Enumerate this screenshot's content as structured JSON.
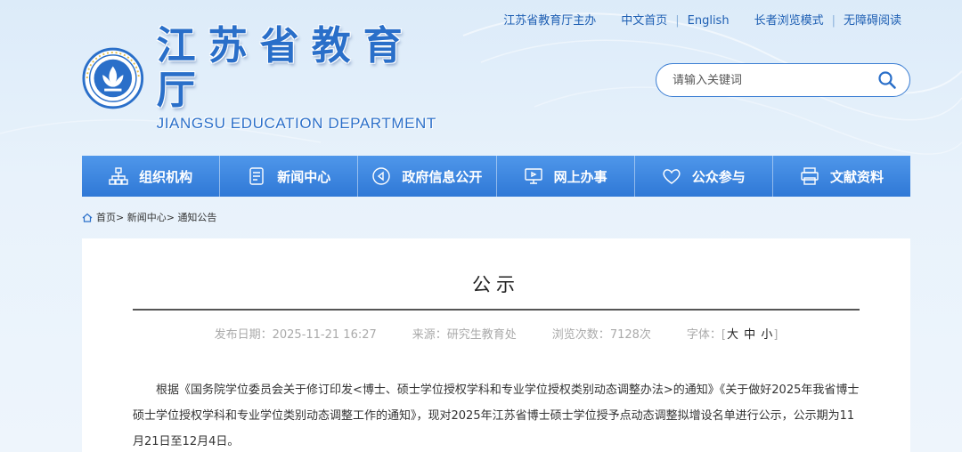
{
  "top_links": {
    "host": "江苏省教育厅主办",
    "home": "中文首页",
    "english": "English",
    "elder_mode": "长者浏览模式",
    "accessible": "无障碍阅读"
  },
  "logo": {
    "name_cn": "江苏省教育厅",
    "name_en": "JIANGSU EDUCATION DEPARTMENT"
  },
  "search": {
    "placeholder": "请输入关键词"
  },
  "nav": {
    "items": [
      {
        "label": "组织机构",
        "icon": "org-chart-icon"
      },
      {
        "label": "新闻中心",
        "icon": "document-icon"
      },
      {
        "label": "政府信息公开",
        "icon": "open-info-icon"
      },
      {
        "label": "网上办事",
        "icon": "monitor-icon"
      },
      {
        "label": "公众参与",
        "icon": "heart-icon"
      },
      {
        "label": "文献资料",
        "icon": "printer-icon"
      }
    ]
  },
  "breadcrumb": {
    "home": "首页",
    "news": "新闻中心",
    "notice": "通知公告"
  },
  "article": {
    "title": "公示",
    "publish_label": "发布日期：",
    "publish_date": "2025-11-21 16:27",
    "source_label": "来源：",
    "source": "研究生教育处",
    "views_label": "浏览次数：",
    "views": "7128次",
    "font_label": "字体：",
    "font_large": "大",
    "font_medium": "中",
    "font_small": "小",
    "body": "根据《国务院学位委员会关于修订印发<博士、硕士学位授权学科和专业学位授权类别动态调整办法>的通知》《关于做好2025年我省博士硕士学位授权学科和专业学位类别动态调整工作的通知》，现对2025年江苏省博士硕士学位授予点动态调整拟增设名单进行公示，公示期为11月21日至12月4日。"
  },
  "colors": {
    "brand_blue": "#2f78d6",
    "nav_top": "#4f97ea",
    "link_blue": "#1e5fb3"
  }
}
